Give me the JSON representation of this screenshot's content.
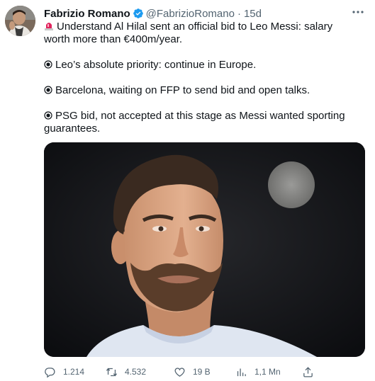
{
  "tweet": {
    "author_name": "Fabrizio Romano",
    "handle": "@FabrizioRomano",
    "separator": "·",
    "time": "15d",
    "paragraphs": [
      "Understand Al Hilal sent an official bid to Leo Messi: salary worth more than €400m/year.",
      "Leo’s absolute priority: continue in Europe.",
      "Barcelona, waiting on FFP to send bid and open talks.",
      "PSG bid, not accepted at this stage as Messi wanted sporting guarantees."
    ],
    "paragraph_prefixes": [
      "siren-emoji",
      "radio-bullet",
      "radio-bullet",
      "radio-bullet"
    ]
  },
  "actions": {
    "replies": "1.214",
    "retweets": "4.532",
    "likes": "19 B",
    "views": "1,1 Mn"
  },
  "icons": {
    "verified": "verified-badge-icon",
    "more": "more-options-icon",
    "reply": "reply-icon",
    "retweet": "retweet-icon",
    "like": "heart-icon",
    "views": "views-chart-icon",
    "share": "share-icon"
  },
  "colors": {
    "text": "#0f1419",
    "muted": "#536471",
    "verified": "#1d9bf0",
    "siren": "#e0245e"
  }
}
